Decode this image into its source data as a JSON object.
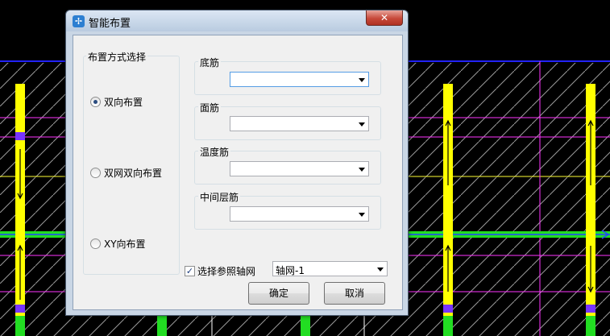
{
  "dialog": {
    "title": "智能布置",
    "close_label": "✕",
    "layout_group": {
      "title": "布置方式选择",
      "options": [
        {
          "label": "双向布置",
          "selected": true
        },
        {
          "label": "双网双向布置",
          "selected": false
        },
        {
          "label": "XY向布置",
          "selected": false
        }
      ]
    },
    "rebar_groups": [
      {
        "title": "底筋",
        "value": ""
      },
      {
        "title": "面筋",
        "value": ""
      },
      {
        "title": "温度筋",
        "value": ""
      },
      {
        "title": "中间层筋",
        "value": ""
      }
    ],
    "reference_axis": {
      "checkbox_label": "选择参照轴网",
      "checked": true,
      "value": "轴网-1"
    },
    "ok_label": "确定",
    "cancel_label": "取消"
  },
  "colors": {
    "background": "#000000",
    "grid_blue": "#2222ff",
    "grid_magenta": "#ff33ff",
    "grid_yellow": "#ffff33",
    "column_yellow": "#ffff00",
    "beam_green": "#22dd22",
    "purple_marker": "#7733ff"
  }
}
